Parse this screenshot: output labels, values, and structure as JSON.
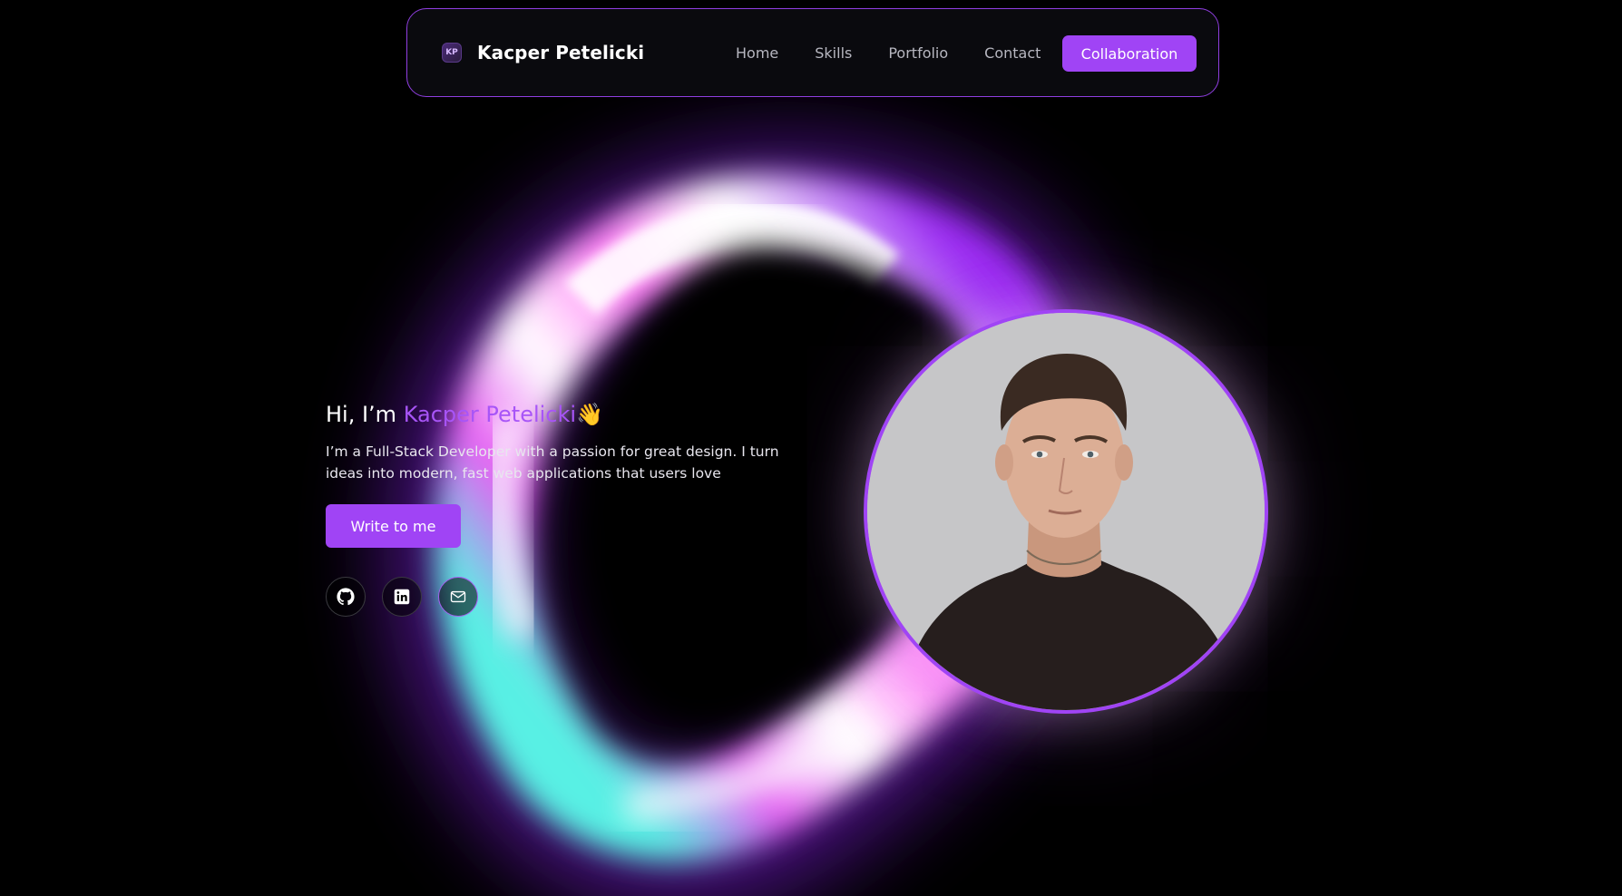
{
  "navbar": {
    "logo_text": "KP",
    "brand": "Kacper Petelicki",
    "links": [
      "Home",
      "Skills",
      "Portfolio",
      "Contact"
    ],
    "cta": "Collaboration"
  },
  "hero": {
    "greeting_prefix": "Hi, I’m ",
    "greeting_name": "Kacper Petelicki",
    "greeting_emoji": "👋",
    "description": "I’m a Full-Stack Developer with a passion for great design. I turn ideas into modern, fast web applications that users love",
    "cta": "Write to me",
    "socials": [
      {
        "icon": "github-icon"
      },
      {
        "icon": "linkedin-icon"
      },
      {
        "icon": "mail-icon"
      }
    ]
  },
  "colors": {
    "accent": "#a044f5",
    "accent_text": "#a855f7",
    "background": "#000000",
    "nav_border": "#8f3ee0"
  }
}
